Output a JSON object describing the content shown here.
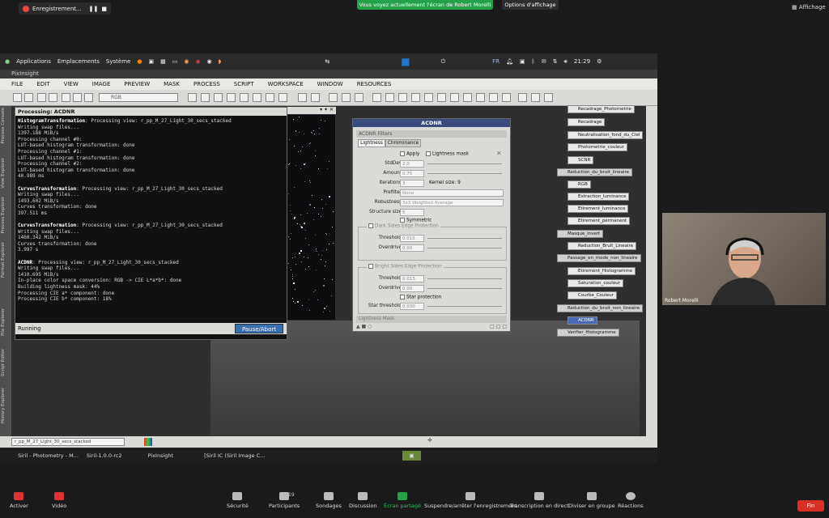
{
  "zoom_top": {
    "recording_label": "Enregistrement...",
    "share_banner": "Vous voyez actuellement l'écran de Robert Morelli",
    "view_options": "Options d'affichage",
    "display_label": "Affichage"
  },
  "linux_bar": {
    "applications": "Applications",
    "places": "Emplacements",
    "system": "Système",
    "lang": "FR",
    "clock": "21:29"
  },
  "pixinsight": {
    "title": "PixInsight",
    "menu": [
      "FILE",
      "EDIT",
      "VIEW",
      "IMAGE",
      "PREVIEW",
      "MASK",
      "PROCESS",
      "SCRIPT",
      "WORKSPACE",
      "WINDOW",
      "RESOURCES"
    ],
    "rgb_select": "RGB",
    "left_tabs": [
      "Process Console",
      "View Explorer",
      "Process Explorer",
      "Format Explorer",
      "File Explorer",
      "Script Editor",
      "History Explorer"
    ],
    "view_select": "r_pp_M_27_Light_30_secs_stacked"
  },
  "console": {
    "title": "Processing: ACDNR",
    "lines": [
      {
        "b": "HistogramTransformation",
        "t": ": Processing view: r_pp_M_27_Light_30_secs_stacked"
      },
      {
        "b": "",
        "t": "Writing swap files..."
      },
      {
        "b": "",
        "t": "1397.188 MiB/s"
      },
      {
        "b": "",
        "t": "Processing channel #0:"
      },
      {
        "b": "",
        "t": "LUT-based histogram transformation: done"
      },
      {
        "b": "",
        "t": "Processing channel #1:"
      },
      {
        "b": "",
        "t": "LUT-based histogram transformation: done"
      },
      {
        "b": "",
        "t": "Processing channel #2:"
      },
      {
        "b": "",
        "t": "LUT-based histogram transformation: done"
      },
      {
        "b": "",
        "t": "40.989 ms"
      },
      {
        "b": "",
        "t": ""
      },
      {
        "b": "CurvesTransformation",
        "t": ": Processing view: r_pp_M_27_Light_30_secs_stacked"
      },
      {
        "b": "",
        "t": "Writing swap files..."
      },
      {
        "b": "",
        "t": "1493.602 MiB/s"
      },
      {
        "b": "",
        "t": "Curves transformation: done"
      },
      {
        "b": "",
        "t": "397.511 ms"
      },
      {
        "b": "",
        "t": ""
      },
      {
        "b": "CurvesTransformation",
        "t": ": Processing view: r_pp_M_27_Light_30_secs_stacked"
      },
      {
        "b": "",
        "t": "Writing swap files..."
      },
      {
        "b": "",
        "t": "1460.342 MiB/s"
      },
      {
        "b": "",
        "t": "Curves transformation: done"
      },
      {
        "b": "",
        "t": "3.997 s"
      },
      {
        "b": "",
        "t": ""
      },
      {
        "b": "ACDNR",
        "t": ": Processing view: r_pp_M_27_Light_30_secs_stacked"
      },
      {
        "b": "",
        "t": "Writing swap files..."
      },
      {
        "b": "",
        "t": "1410.695 MiB/s"
      },
      {
        "b": "",
        "t": "In-place color space conversion: RGB -> CIE L*a*b*: done"
      },
      {
        "b": "",
        "t": "Building lightness mask:  44%"
      },
      {
        "b": "",
        "t": "Processing CIE a* component: done"
      },
      {
        "b": "",
        "t": "Processing CIE b* component:  18%"
      }
    ],
    "status": "Running",
    "pause_label": "Pause/Abort"
  },
  "acdnr": {
    "title": "ACDNR",
    "filters_label": "ACDNR Filters",
    "tab_lightness": "Lightness",
    "tab_chrominance": "Chrominance",
    "apply": "Apply",
    "lightness_mask": "Lightness mask",
    "stddev_label": "StdDev:",
    "stddev": "2.0",
    "amount_label": "Amount:",
    "amount": "0.75",
    "iterations_label": "Iterations:",
    "iterations": "3",
    "kernel_size": "Kernel size: 9",
    "prefilter_label": "Prefilter:",
    "prefilter": "None",
    "robustness_label": "Robustness:",
    "robustness": "3x3 Weighted Average",
    "structure_label": "Structure size:",
    "structure": "5",
    "symmetric": "Symmetric",
    "dark_sides": "Dark Sides Edge Protection",
    "bright_sides": "Bright Sides Edge Protection",
    "threshold_label": "Threshold:",
    "dark_threshold": "0.015",
    "bright_threshold": "0.013",
    "overdrive_label": "Overdrive:",
    "dark_overdrive": "0.00",
    "bright_overdrive": "0.00",
    "star_protection": "Star protection",
    "star_threshold_label": "Star threshold:",
    "star_threshold": "0.030",
    "lightness_mask_section": "Lightness Mask"
  },
  "process_icons": [
    "Recadrage_Photometrie",
    "Recadrage",
    "Neutralisation_fond_du_Ciel",
    "Photometrie_couleur",
    "SCNR",
    "Reduction_du_bruit_lineaire",
    "RGB",
    "Extraction_luminance",
    "Etirement_luminance",
    "Etirement_permanent",
    "Masque_invert",
    "Reduction_Bruit_Lineaire",
    "Passage_en_mode_non_lineaire",
    "Etirement_Histogramme",
    "Saturation_couleur",
    "Courbe_Couleur",
    "Reduction_du_bruit_non_lineaire",
    "ACDNR",
    "Verifier_Histogramme"
  ],
  "taskbar": [
    "Siril - Photometry - M...",
    "Siril-1.0.0-rc2",
    "PixInsight",
    "[Siril IC (Siril Image C..."
  ],
  "camera": {
    "name": "Robert Morelli"
  },
  "zoom_bottom": {
    "activate": "Activer",
    "video": "Vidéo",
    "security": "Sécurité",
    "participants": "Participants",
    "participants_count": "19",
    "polls": "Sondages",
    "discussion": "Discussion",
    "share": "Écran partagé",
    "recording": "Suspendre/arrêter l'enregistrement",
    "live_transcription": "Transcription en direct",
    "rooms": "Diviser en groupe",
    "reactions": "Réactions",
    "end": "Fin"
  },
  "colors": {
    "share_green": "#24a148",
    "end_red": "#d93025",
    "pi_blue": "#3a4a7a"
  }
}
